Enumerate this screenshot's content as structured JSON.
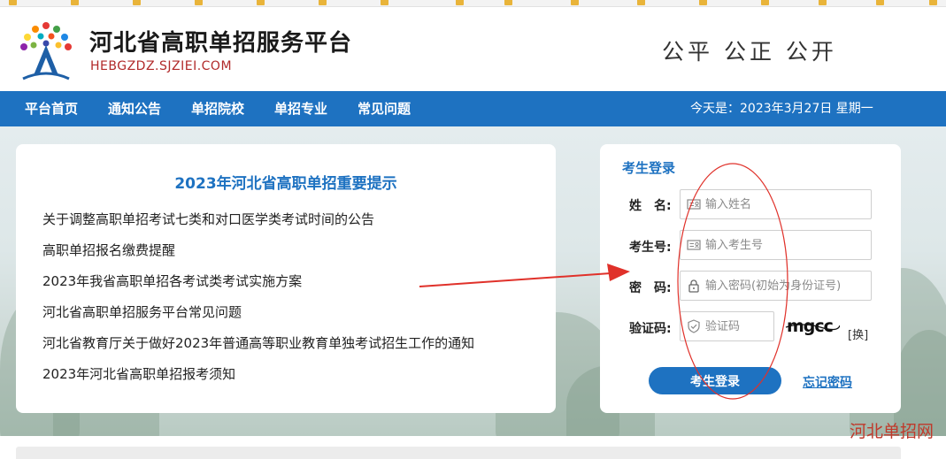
{
  "header": {
    "site_title": "河北省高职单招服务平台",
    "site_domain": "HEBGZDZ.SJZIEI.COM",
    "slogan": "公平 公正 公开"
  },
  "nav": {
    "items": [
      "平台首页",
      "通知公告",
      "单招院校",
      "单招专业",
      "常见问题"
    ],
    "date_text": "今天是：2023年3月27日 星期一"
  },
  "notice": {
    "title": "2023年河北省高职单招重要提示",
    "items": [
      "关于调整高职单招考试七类和对口医学类考试时间的公告",
      "高职单招报名缴费提醒",
      "2023年我省高职单招各考试类考试实施方案",
      "河北省高职单招服务平台常见问题",
      "河北省教育厅关于做好2023年普通高等职业教育单独考试招生工作的通知",
      "2023年河北省高职单招报考须知"
    ]
  },
  "login": {
    "title": "考生登录",
    "name_label": "姓　名:",
    "name_placeholder": "输入姓名",
    "id_label": "考生号:",
    "id_placeholder": "输入考生号",
    "password_label": "密　码:",
    "password_placeholder": "输入密码(初始为身份证号)",
    "captcha_label": "验证码:",
    "captcha_placeholder": "验证码",
    "captcha_text": "mgcc",
    "refresh_label": "[换]",
    "submit_label": "考生登录",
    "forgot_label": "忘记密码"
  },
  "watermark": "河北单招网",
  "colors": {
    "brand_blue": "#1e72c1",
    "annotation_red": "#e0312a",
    "domain_red": "#b12a2a"
  }
}
